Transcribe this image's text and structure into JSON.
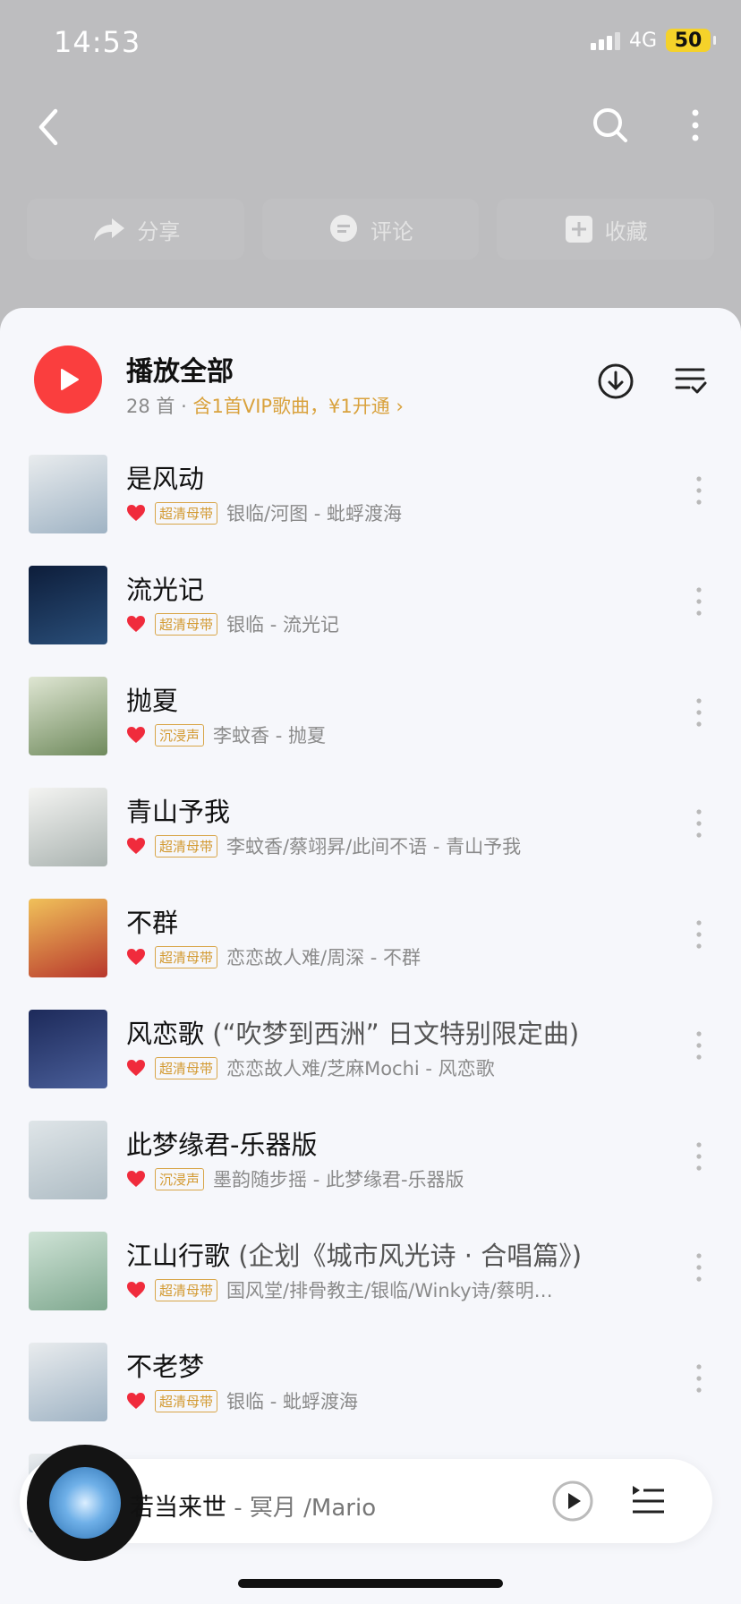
{
  "status": {
    "time": "14:53",
    "network": "4G",
    "battery": "50"
  },
  "actions": [
    {
      "label": "分享",
      "icon": "share-icon"
    },
    {
      "label": "评论",
      "icon": "comment-icon"
    },
    {
      "label": "收藏",
      "icon": "collect-icon"
    }
  ],
  "play_all": {
    "title": "播放全部",
    "count": "28 首",
    "dot": "·",
    "vip_text": "含1首VIP歌曲，¥1开通",
    "chevron": "›"
  },
  "songs": [
    {
      "title": "是风动",
      "subtitle": "",
      "badge": "超清母带",
      "artists": "银临/河图 - 蚍蜉渡海",
      "cover": [
        "#e9ecee",
        "#9fb3c4"
      ]
    },
    {
      "title": "流光记",
      "subtitle": "",
      "badge": "超清母带",
      "artists": "银临 - 流光记",
      "cover": [
        "#0d1d3a",
        "#2a4f7a"
      ]
    },
    {
      "title": "抛夏",
      "subtitle": "",
      "badge": "沉浸声",
      "artists": "李蚊香 - 抛夏",
      "cover": [
        "#dfe6d3",
        "#6f8a5c"
      ]
    },
    {
      "title": "青山予我",
      "subtitle": "",
      "badge": "超清母带",
      "artists": "李蚊香/蔡翊昇/此间不语 - 青山予我",
      "cover": [
        "#f4f4f2",
        "#aab3b0"
      ]
    },
    {
      "title": "不群",
      "subtitle": "",
      "badge": "超清母带",
      "artists": "恋恋故人难/周深 - 不群",
      "cover": [
        "#f0c15a",
        "#b8372c"
      ]
    },
    {
      "title": "风恋歌",
      "subtitle": " (“吹梦到西洲” 日文特别限定曲)",
      "badge": "超清母带",
      "artists": "恋恋故人难/芝麻Mochi - 风恋歌",
      "cover": [
        "#1d2a5a",
        "#4a5f9a"
      ]
    },
    {
      "title": "此梦缘君-乐器版",
      "subtitle": "",
      "badge": "沉浸声",
      "artists": "墨韵随步摇 - 此梦缘君-乐器版",
      "cover": [
        "#dfe5e8",
        "#aebcc4"
      ]
    },
    {
      "title": "江山行歌",
      "subtitle": " (企划《城市风光诗 · 合唱篇》)",
      "badge": "超清母带",
      "artists": "国风堂/排骨教主/银临/Winky诗/蔡明…",
      "cover": [
        "#cfe3d6",
        "#7fa88f"
      ]
    },
    {
      "title": "不老梦",
      "subtitle": "",
      "badge": "超清母带",
      "artists": "银临 - 蚍蜉渡海",
      "cover": [
        "#e9ecee",
        "#9fb3c4"
      ]
    }
  ],
  "now_playing": {
    "title": "若当来世",
    "artist": " - 冥月 /Mario"
  }
}
